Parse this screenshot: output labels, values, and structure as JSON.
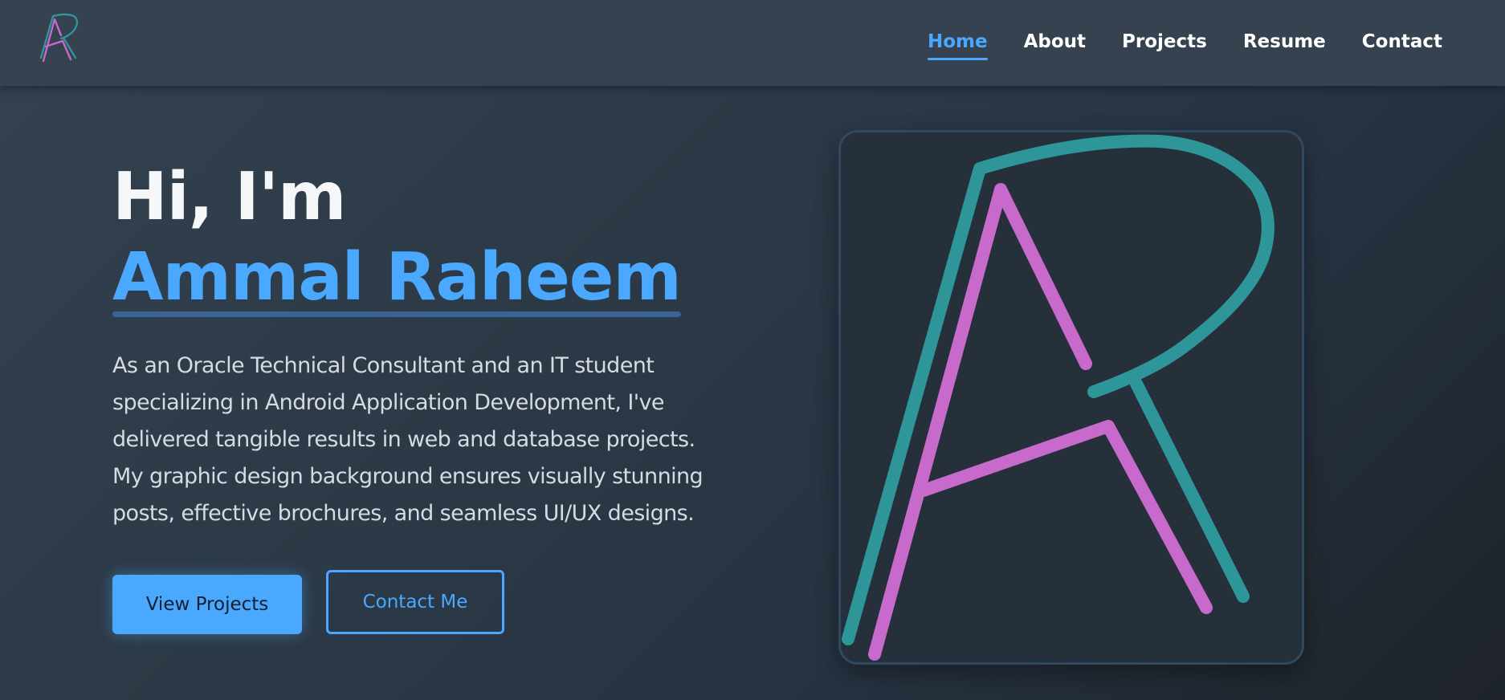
{
  "nav": {
    "logo_icon": "ar-monogram-logo-icon",
    "links": [
      {
        "label": "Home",
        "active": true
      },
      {
        "label": "About",
        "active": false
      },
      {
        "label": "Projects",
        "active": false
      },
      {
        "label": "Resume",
        "active": false
      },
      {
        "label": "Contact",
        "active": false
      }
    ]
  },
  "hero": {
    "greeting": "Hi, I'm",
    "name": "Ammal Raheem",
    "bio": "As an Oracle Technical Consultant and an IT student specializing in Android Application Development, I've delivered tangible results in web and database projects. My graphic design background ensures visually stunning posts, effective brochures, and seamless UI/UX designs.",
    "primary_button": "View Projects",
    "secondary_button": "Contact Me",
    "illustration_icon": "ar-monogram-icon"
  },
  "colors": {
    "accent": "#4aa8ff",
    "teal": "#2e9599",
    "magenta": "#c76acb",
    "navbar": "#36424f"
  }
}
